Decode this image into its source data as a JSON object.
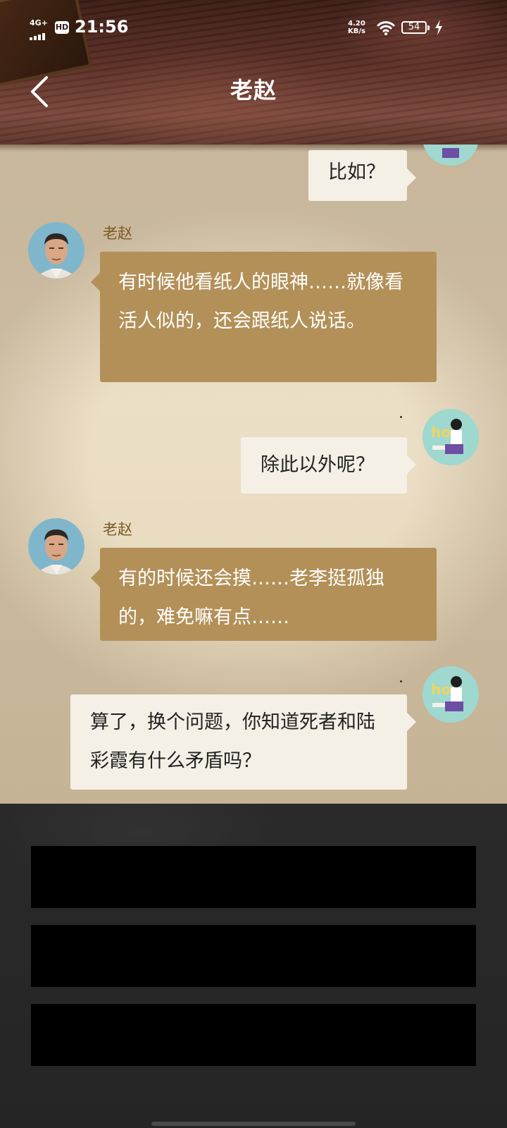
{
  "status_bar": {
    "network": "4G+",
    "hd": "HD",
    "time": "21:56",
    "speed_value": "4.20",
    "speed_unit": "KB/s",
    "battery": "54"
  },
  "header": {
    "title": "老赵"
  },
  "chat": {
    "messages": [
      {
        "sender": "",
        "side": "right",
        "text": "比如？"
      },
      {
        "sender": "老赵",
        "side": "left",
        "text": "有时候他看纸人的眼神……就像看活人似的，还会跟纸人说话。"
      },
      {
        "sender": "",
        "side": "right",
        "text": "除此以外呢？"
      },
      {
        "sender": "老赵",
        "side": "left",
        "text": "有的时候还会摸……老李挺孤独的，难免嘛有点……"
      },
      {
        "sender": "",
        "side": "right",
        "text": "算了，换个问题，你知道死者和陆彩霞有什么矛盾吗？"
      }
    ]
  },
  "options": {
    "count": 3
  },
  "colors": {
    "npc_bubble": "#b39058",
    "player_bubble": "#f5f0e6",
    "name_text": "#7d5a24",
    "panel_bg": "#252525"
  },
  "icons": {
    "back": "chevron-left-icon",
    "wifi": "wifi-icon",
    "charging": "lightning-icon"
  }
}
